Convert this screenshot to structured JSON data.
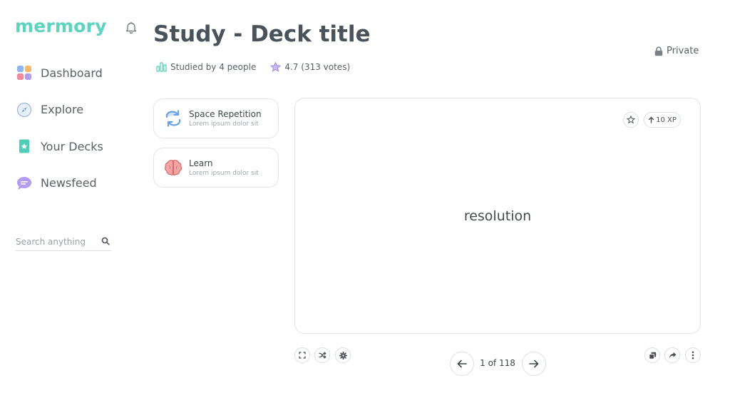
{
  "app": {
    "logo": "mermory"
  },
  "sidebar": {
    "items": [
      {
        "label": "Dashboard",
        "icon": "dashboard-icon"
      },
      {
        "label": "Explore",
        "icon": "compass-icon"
      },
      {
        "label": "Your Decks",
        "icon": "deck-icon"
      },
      {
        "label": "Newsfeed",
        "icon": "chat-icon"
      }
    ],
    "search": {
      "placeholder": "Search anything",
      "value": ""
    }
  },
  "header": {
    "title": "Study - Deck title",
    "studied": "Studied by 4 people",
    "rating": "4.7 (313 votes)",
    "privacy": "Private"
  },
  "modes": [
    {
      "title": "Space Repetition",
      "subtitle": "Lorem ipsum dolor sit",
      "icon": "repeat-icon"
    },
    {
      "title": "Learn",
      "subtitle": "Lorem ipsum dolor sit",
      "icon": "brain-icon"
    }
  ],
  "card": {
    "word": "resolution",
    "xp": "10 XP"
  },
  "pager": {
    "text": "1 of 118"
  },
  "colors": {
    "brand": "#5dd3c0",
    "text": "#4a5359",
    "border": "#e1e4e7"
  }
}
